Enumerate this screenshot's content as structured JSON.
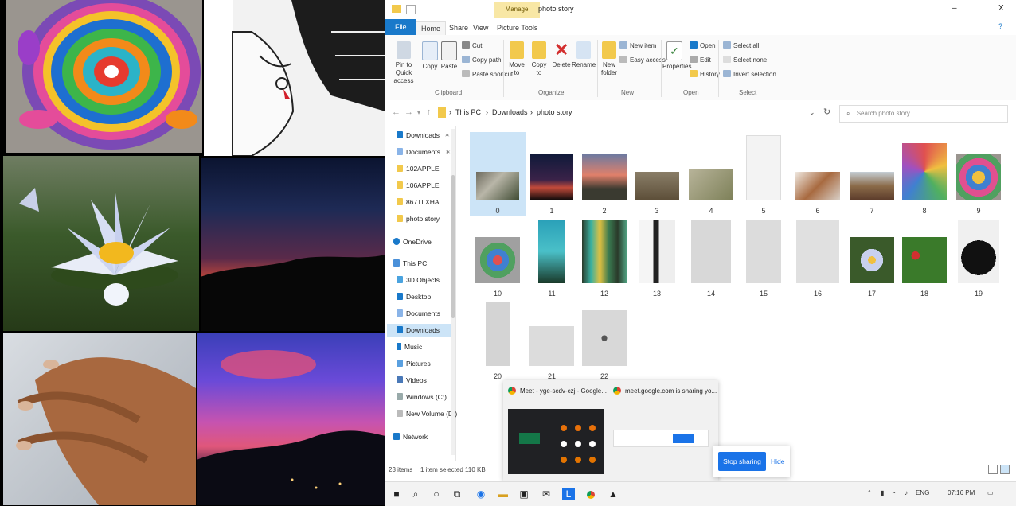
{
  "window": {
    "title": "photo story",
    "manage_tab": "Manage",
    "picture_tools": "Picture Tools",
    "minimize": "–",
    "maximize": "□",
    "close": "X"
  },
  "ribbon_tabs": [
    "File",
    "Home",
    "Share",
    "View"
  ],
  "ribbon": {
    "pin_quick": "Pin to Quick access",
    "copy": "Copy",
    "paste": "Paste",
    "cut": "Cut",
    "copy_path": "Copy path",
    "paste_shortcut": "Paste shortcut",
    "clipboard": "Clipboard",
    "move_to": "Move to",
    "copy_to": "Copy to",
    "delete": "Delete",
    "rename": "Rename",
    "organize": "Organize",
    "new_folder": "New folder",
    "new_item": "New item",
    "easy_access": "Easy access",
    "new": "New",
    "properties": "Properties",
    "open": "Open",
    "edit": "Edit",
    "history": "History",
    "open_group": "Open",
    "select_all": "Select all",
    "select_none": "Select none",
    "invert_selection": "Invert selection",
    "select": "Select"
  },
  "address": {
    "crumbs": [
      "This PC",
      "Downloads",
      "photo story"
    ],
    "search_placeholder": "Search photo story"
  },
  "nav": {
    "quick": [
      "Downloads",
      "Documents",
      "102APPLE",
      "106APPLE",
      "867TLXHA",
      "photo story"
    ],
    "onedrive": "OneDrive",
    "this_pc": "This PC",
    "pc_items": [
      "3D Objects",
      "Desktop",
      "Documents",
      "Downloads",
      "Music",
      "Pictures",
      "Videos",
      "Windows (C:)",
      "New Volume (D:)"
    ],
    "network": "Network"
  },
  "files": [
    "0",
    "1",
    "2",
    "3",
    "4",
    "5",
    "6",
    "7",
    "8",
    "9",
    "10",
    "11",
    "12",
    "13",
    "14",
    "15",
    "16",
    "17",
    "18",
    "19",
    "20",
    "21",
    "22"
  ],
  "status": {
    "items": "23 items",
    "selected": "1 item selected  110 KB"
  },
  "meet_popup": {
    "tab_title": "Meet - yge-scdv-czj - Google...",
    "sharing_text": "meet.google.com is sharing yo..."
  },
  "share_bar": {
    "stop": "Stop sharing",
    "hide": "Hide"
  },
  "taskbar": {
    "lang": "ENG",
    "time": "07:16 PM"
  },
  "colors": {
    "accent": "#1a73e8",
    "ribbon_file_tab": "#1979ca",
    "selection": "#cce4f7"
  }
}
